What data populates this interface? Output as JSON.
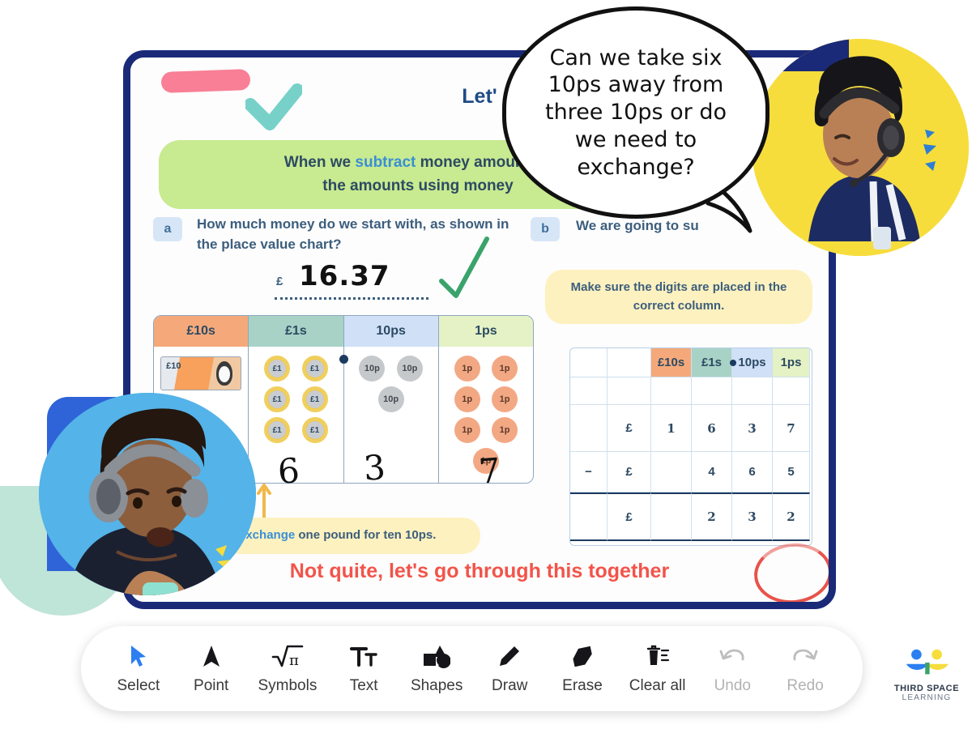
{
  "slide": {
    "title": "Let'",
    "banner_parts": [
      "When we ",
      "subtract",
      " money amounts u",
      "the amounts using money"
    ],
    "banner_line1_pre": "When we ",
    "banner_line1_hl": "subtract",
    "banner_line1_post": " money amounts u",
    "banner_line2": "the amounts using money",
    "questions": [
      {
        "badge": "a",
        "text": "How much money do we start with, as shown in the place value chart?",
        "currency_symbol": "£",
        "answer_value": "16.37",
        "marked_correct": true
      },
      {
        "badge": "b",
        "text": "We are going to su",
        "hint": "Make sure the digits are placed in the correct column."
      }
    ],
    "bottom_hint_pre": "exchange",
    "bottom_hint_post": " one pound for ten 10ps.",
    "feedback": "Not quite, let's go through this together"
  },
  "place_value_chart": {
    "columns": [
      {
        "label": "£10s",
        "color": "#f5a97a",
        "count_written": ""
      },
      {
        "label": "£1s",
        "color": "#a8d2c6",
        "count_written": "6"
      },
      {
        "label": "10ps",
        "color": "#cfe0f7",
        "count_written": "3"
      },
      {
        "label": "1ps",
        "color": "#e4f2c5",
        "count_written": "7"
      }
    ],
    "note_label": "£10",
    "pound_coin_label": "£1",
    "pound_coin_count": 6,
    "tenp_coin_label": "10p",
    "tenp_coin_count": 3,
    "onep_coin_label": "1p",
    "onep_coin_count": 7,
    "decimal_point": true
  },
  "subtraction_grid": {
    "headers": [
      "£10s",
      "£1s",
      "10ps",
      "1ps"
    ],
    "rows": [
      {
        "operator": "",
        "currency": "£",
        "digits": [
          "1",
          "6",
          "3",
          "7"
        ],
        "style": "handwritten"
      },
      {
        "operator": "−",
        "currency": "£",
        "digits": [
          "",
          "4",
          "6",
          "5"
        ],
        "style": "printed"
      },
      {
        "operator": "",
        "currency": "£",
        "digits": [
          "",
          "2",
          "3",
          "2"
        ],
        "style": "handwritten",
        "circled": true
      }
    ]
  },
  "speech_bubble": {
    "text": "Can we take six 10ps away from three 10ps or do we need to exchange?"
  },
  "toolbar": {
    "items": [
      {
        "label": "Select",
        "icon": "cursor-icon",
        "active": true,
        "disabled": false
      },
      {
        "label": "Point",
        "icon": "pointer-arrow-icon",
        "active": false,
        "disabled": false
      },
      {
        "label": "Symbols",
        "icon": "math-symbols-icon",
        "active": false,
        "disabled": false
      },
      {
        "label": "Text",
        "icon": "text-icon",
        "active": false,
        "disabled": false
      },
      {
        "label": "Shapes",
        "icon": "shapes-icon",
        "active": false,
        "disabled": false
      },
      {
        "label": "Draw",
        "icon": "pencil-icon",
        "active": false,
        "disabled": false
      },
      {
        "label": "Erase",
        "icon": "eraser-icon",
        "active": false,
        "disabled": false
      },
      {
        "label": "Clear all",
        "icon": "trash-icon",
        "active": false,
        "disabled": false
      },
      {
        "label": "Undo",
        "icon": "undo-icon",
        "active": false,
        "disabled": true
      },
      {
        "label": "Redo",
        "icon": "redo-icon",
        "active": false,
        "disabled": true
      }
    ]
  },
  "logo": {
    "line1": "THIRD SPACE",
    "line2": "LEARNING"
  },
  "colors": {
    "frame_navy": "#1b2a78",
    "banner_green": "#c8ea91",
    "hint_yellow": "#fdf1bf",
    "accent_blue": "#3a8fd4",
    "feedback_red": "#f2544a",
    "tutor_bg": "#f6dd3c",
    "student_bg": "#54b3e8"
  }
}
